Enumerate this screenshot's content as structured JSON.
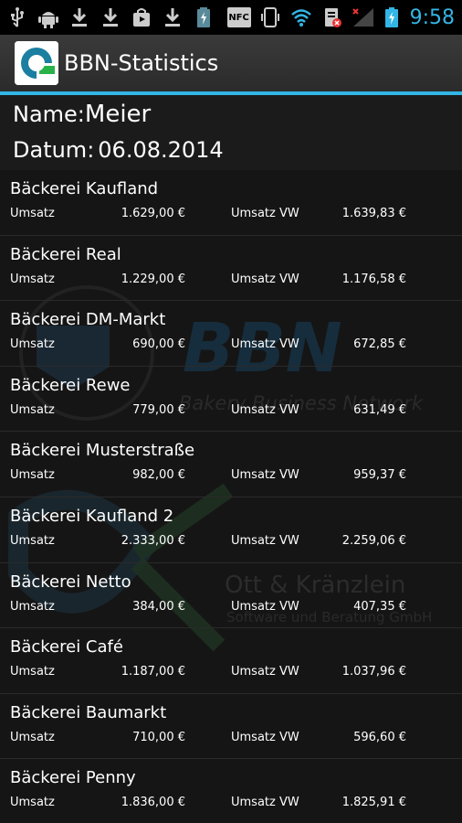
{
  "status_bar": {
    "time": "9:58",
    "icons": [
      "usb-icon",
      "android-icon",
      "download-icon",
      "download-icon",
      "shopping-bag-icon",
      "download-icon",
      "battery-small-icon",
      "nfc-icon",
      "phone-vibrate-icon",
      "wifi-icon",
      "sim-error-icon",
      "signal-icon",
      "battery-charging-icon"
    ],
    "nfc_label": "NFC"
  },
  "action_bar": {
    "title": "BBN-Statistics"
  },
  "header": {
    "name_label": "Name:",
    "name_value": "Meier",
    "date_label": "Datum:",
    "date_value": "06.08.2014"
  },
  "watermark": {
    "brand": "BBN",
    "brand_subtitle": "Bakery Business Network",
    "company": "Ott & Kränzlein",
    "company_subtitle": "Software und Beratung GmbH"
  },
  "list": {
    "umsatz_label": "Umsatz",
    "umsatz_vw_label": "Umsatz VW",
    "items": [
      {
        "name": "Bäckerei Kaufland",
        "umsatz": "1.629,00 €",
        "umsatz_vw": "1.639,83 €"
      },
      {
        "name": "Bäckerei Real",
        "umsatz": "1.229,00 €",
        "umsatz_vw": "1.176,58 €"
      },
      {
        "name": "Bäckerei DM-Markt",
        "umsatz": "690,00 €",
        "umsatz_vw": "672,85 €"
      },
      {
        "name": "Bäckerei Rewe",
        "umsatz": "779,00 €",
        "umsatz_vw": "631,49 €"
      },
      {
        "name": "Bäckerei Musterstraße",
        "umsatz": "982,00 €",
        "umsatz_vw": "959,37 €"
      },
      {
        "name": "Bäckerei Kaufland 2",
        "umsatz": "2.333,00 €",
        "umsatz_vw": "2.259,06 €"
      },
      {
        "name": "Bäckerei Netto",
        "umsatz": "384,00 €",
        "umsatz_vw": "407,35 €"
      },
      {
        "name": "Bäckerei Café",
        "umsatz": "1.187,00 €",
        "umsatz_vw": "1.037,96 €"
      },
      {
        "name": "Bäckerei Baumarkt",
        "umsatz": "710,00 €",
        "umsatz_vw": "596,60 €"
      },
      {
        "name": "Bäckerei Penny",
        "umsatz": "1.836,00 €",
        "umsatz_vw": "1.825,91 €"
      }
    ]
  },
  "colors": {
    "accent": "#33b5e5",
    "background": "#151515",
    "header_bg": "#1b1b1b"
  }
}
